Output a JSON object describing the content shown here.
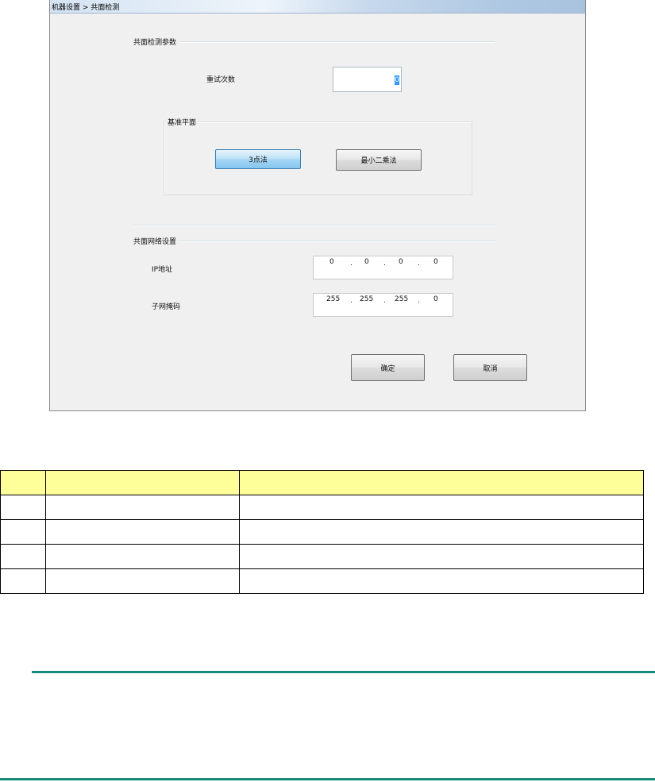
{
  "dialog": {
    "title": "机器设置 > 共面检测",
    "params_group": "共面检测参数",
    "retry_label": "重试次数",
    "retry_value": "0",
    "base_plane": {
      "title": "基准平面",
      "btn_3point": "3点法",
      "btn_least_squares": "最小二乘法"
    },
    "network_group": "共面网络设置",
    "ip_label": "IP地址",
    "ip_octets": [
      "0",
      "0",
      "0",
      "0"
    ],
    "mask_label": "子网掩码",
    "mask_octets": [
      "255",
      "255",
      "255",
      "0"
    ],
    "ok_label": "确定",
    "cancel_label": "取消"
  },
  "table": {
    "rows": [
      [
        "",
        "",
        ""
      ],
      [
        "",
        "",
        ""
      ],
      [
        "",
        "",
        ""
      ],
      [
        "",
        "",
        ""
      ],
      [
        "",
        "",
        ""
      ]
    ],
    "header_color": "#ffff99"
  },
  "colors": {
    "rule": "#178a7a",
    "accent_button": "#a3d4f4"
  }
}
